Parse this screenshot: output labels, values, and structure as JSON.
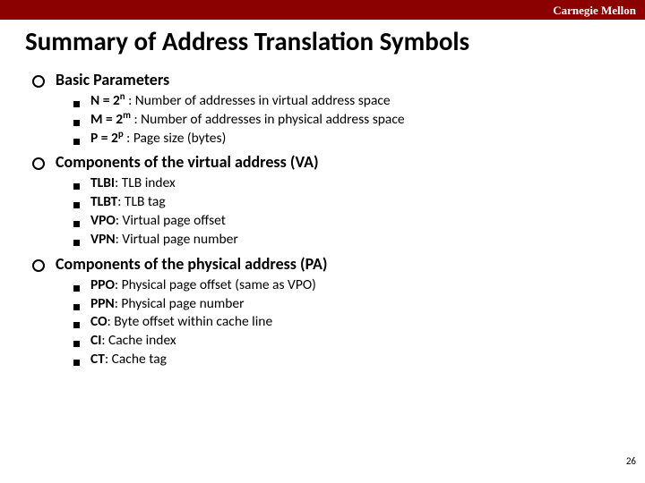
{
  "header": {
    "brand": "Carnegie Mellon"
  },
  "title": "Summary of Address Translation Symbols",
  "sections": [
    {
      "heading": "Basic Parameters",
      "items": [
        {
          "lead": "N = 2",
          "sup": "n",
          "rest": " : Number of addresses in virtual address space"
        },
        {
          "lead": "M = 2",
          "sup": "m",
          "rest": " : Number of addresses in physical address space"
        },
        {
          "lead": "P = 2",
          "sup": "p",
          "rest": "  : Page size (bytes)"
        }
      ]
    },
    {
      "heading": "Components of the virtual address (VA)",
      "items": [
        {
          "lead": "TLBI",
          "rest": ": TLB index"
        },
        {
          "lead": "TLBT",
          "rest": ": TLB tag"
        },
        {
          "lead": "VPO",
          "rest": ": Virtual page offset"
        },
        {
          "lead": "VPN",
          "rest": ": Virtual page number"
        }
      ]
    },
    {
      "heading": "Components of the physical address (PA)",
      "items": [
        {
          "lead": "PPO",
          "rest": ": Physical page offset (same as VPO)"
        },
        {
          "lead": "PPN",
          "rest": ": Physical page number"
        },
        {
          "lead": "CO",
          "rest": ": Byte offset within cache line"
        },
        {
          "lead": "CI",
          "rest": ": Cache index"
        },
        {
          "lead": "CT",
          "rest": ": Cache tag"
        }
      ]
    }
  ],
  "page_number": "26"
}
